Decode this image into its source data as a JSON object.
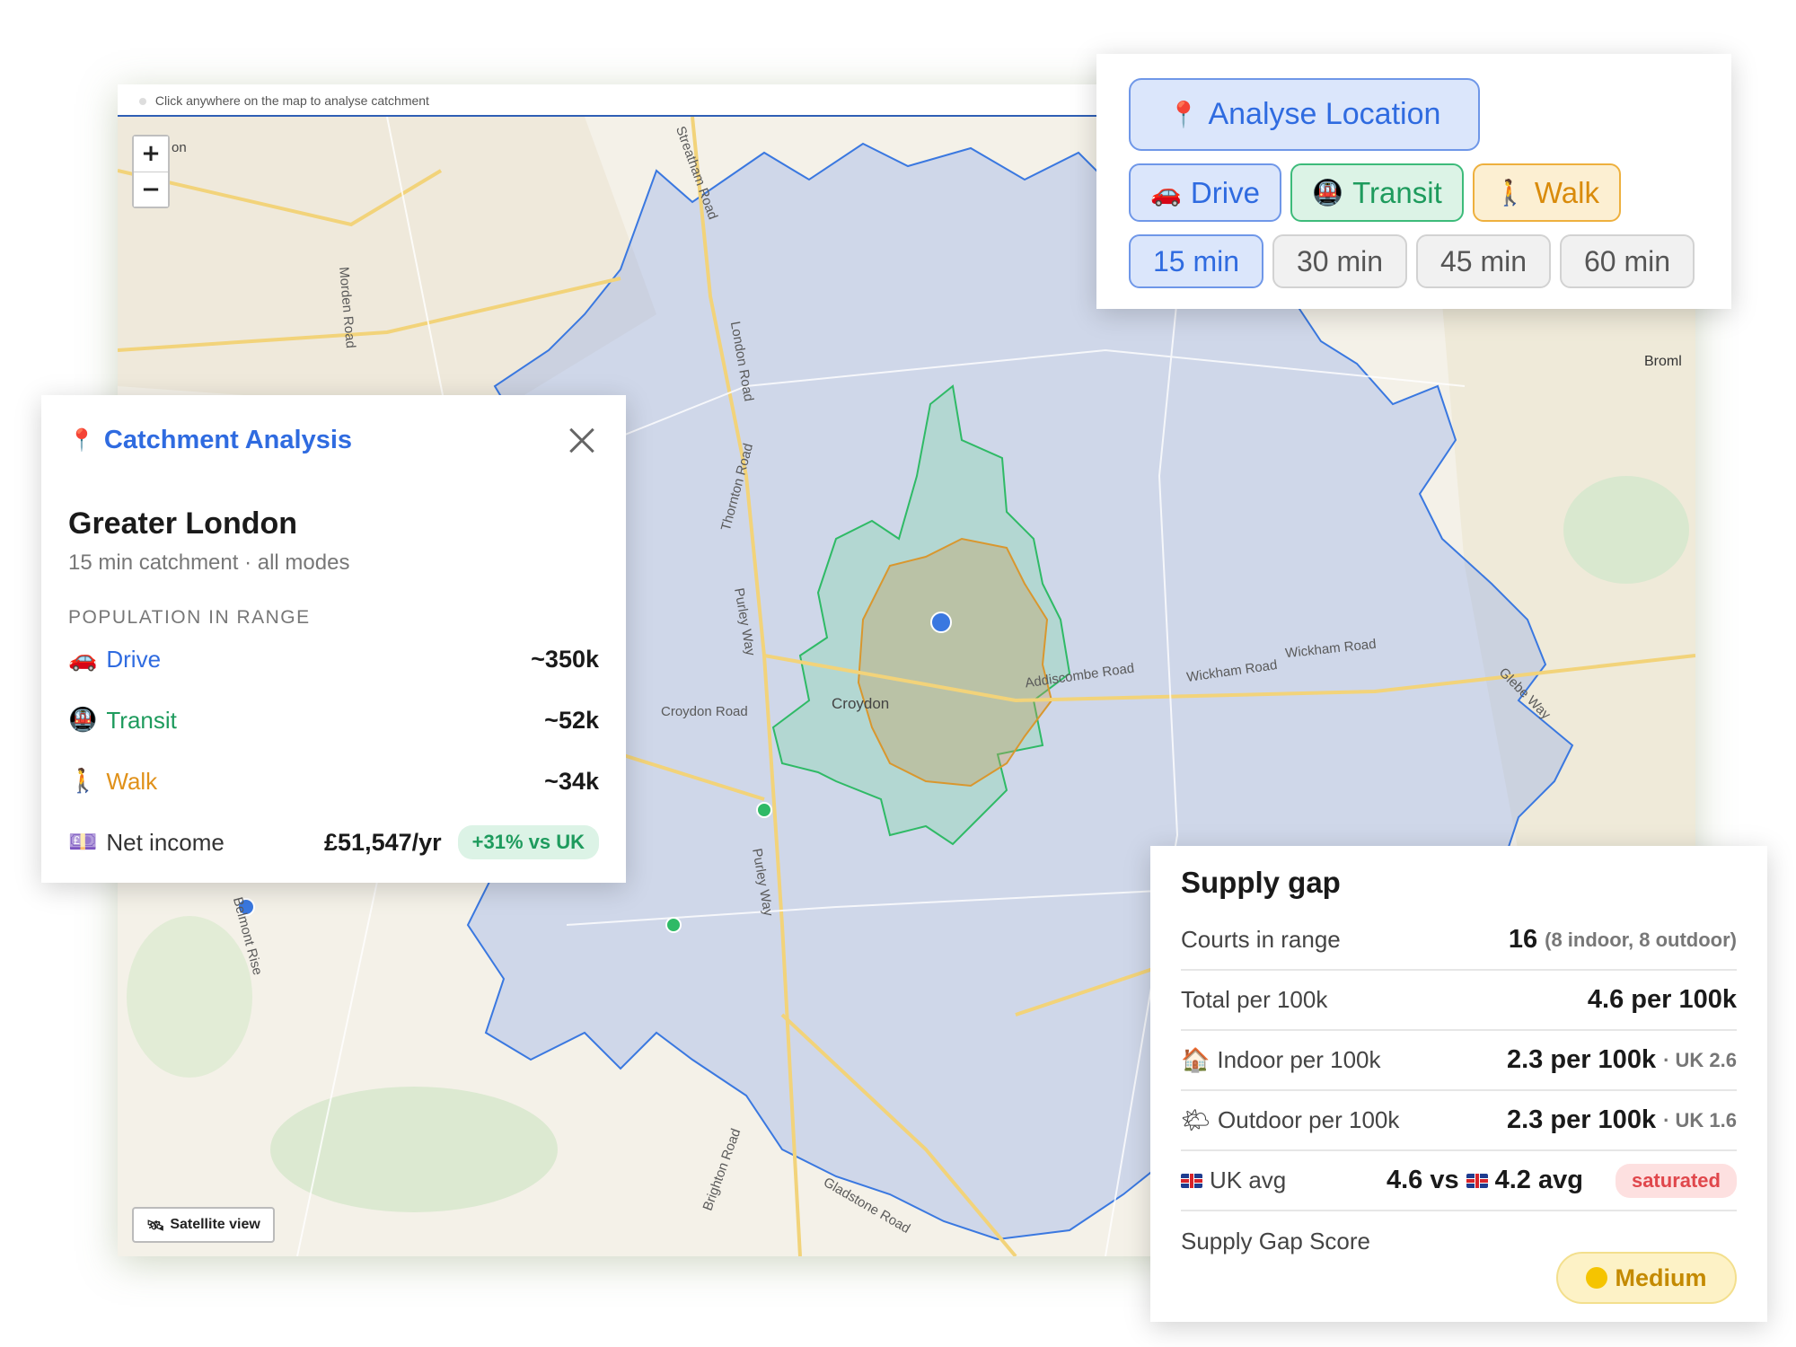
{
  "map": {
    "hint": "Click anywhere on the map to analyse catchment",
    "zoom_in": "+",
    "zoom_out": "−",
    "satellite_label": "Satellite view",
    "labels": {
      "croydon": "Croydon",
      "addiscombe": "Addiscombe Road",
      "wickham1": "Wickham Road",
      "wickham2": "Wickham Road",
      "london_road": "London Road",
      "thornton": "Thornton Road",
      "purley1": "Purley Way",
      "purley2": "Purley Way",
      "croydon_road": "Croydon Road",
      "morden": "Morden Road",
      "streatham": "Streatham Road",
      "bromley": "Broml",
      "belmont": "Belmont Rise",
      "brighton": "Brighton Road",
      "gladstone": "Gladstone Road",
      "glebe": "Glebe Way",
      "top_left": "on"
    },
    "colors": {
      "drive": "#3a78e0",
      "transit": "#2fba66",
      "walk": "#d9972e"
    }
  },
  "toolbar": {
    "analyse_label": "Analyse Location",
    "modes": [
      {
        "label": "Drive",
        "icon": "car-icon",
        "glyph": "🚗"
      },
      {
        "label": "Transit",
        "icon": "train-icon",
        "glyph": "🚇"
      },
      {
        "label": "Walk",
        "icon": "walking-person-icon",
        "glyph": "🚶"
      }
    ],
    "times": [
      "15 min",
      "30 min",
      "45 min",
      "60 min"
    ],
    "active_time": "15 min"
  },
  "catchment": {
    "title": "Catchment Analysis",
    "place": "Greater London",
    "subtitle": "15 min catchment · all modes",
    "section_label": "POPULATION IN RANGE",
    "rows": [
      {
        "label": "Drive",
        "value": "~350k",
        "glyph": "🚗"
      },
      {
        "label": "Transit",
        "value": "~52k",
        "glyph": "🚇"
      },
      {
        "label": "Walk",
        "value": "~34k",
        "glyph": "🚶"
      }
    ],
    "income": {
      "label": "Net income",
      "value": "£51,547/yr",
      "badge": "+31% vs UK",
      "glyph": "💷"
    }
  },
  "supply": {
    "title": "Supply gap",
    "courts": {
      "label": "Courts in range",
      "value": "16",
      "note": "(8 indoor, 8 outdoor)"
    },
    "total": {
      "label": "Total per 100k",
      "value": "4.6 per 100k"
    },
    "indoor": {
      "label": "Indoor per 100k",
      "value": "2.3 per 100k",
      "note": "· UK 2.6",
      "glyph": "🏠"
    },
    "outdoor": {
      "label": "Outdoor per 100k",
      "value": "2.3 per 100k",
      "note": "· UK 1.6",
      "glyph": "🌤"
    },
    "uk": {
      "label": "UK avg",
      "value_a": "4.6 vs",
      "value_b": "4.2 avg",
      "badge": "saturated"
    },
    "score": {
      "label": "Supply Gap Score",
      "value": "Medium"
    }
  }
}
